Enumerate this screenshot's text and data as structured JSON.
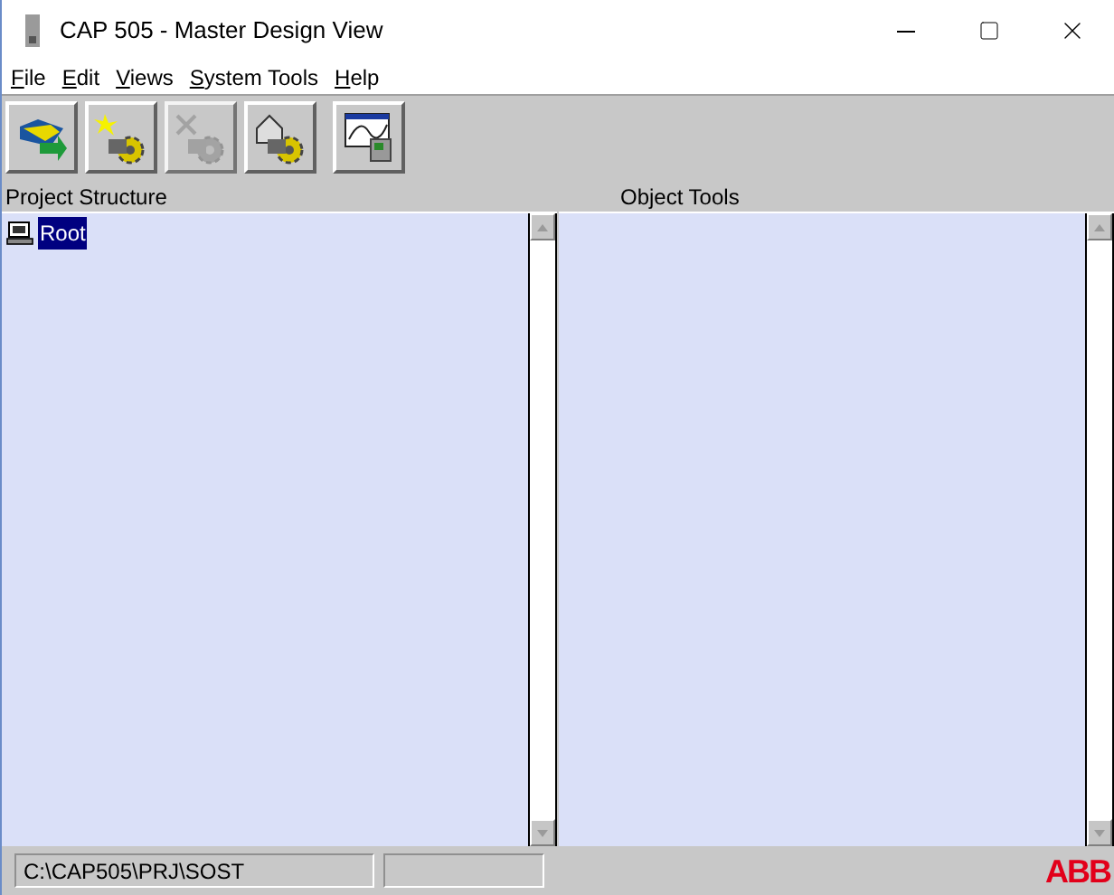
{
  "window": {
    "title": "CAP 505 - Master Design View"
  },
  "menu": [
    {
      "label": "File"
    },
    {
      "label": "Edit"
    },
    {
      "label": "Views"
    },
    {
      "label": "System Tools"
    },
    {
      "label": "Help"
    }
  ],
  "toolbar": [
    {
      "kind": "folder",
      "disabled": false
    },
    {
      "kind": "new",
      "disabled": false
    },
    {
      "kind": "delete",
      "disabled": true
    },
    {
      "kind": "house",
      "disabled": false
    },
    {
      "kind": "monitor",
      "disabled": false
    }
  ],
  "panes": [
    {
      "title": "Project Structure",
      "items": [
        {
          "label": "Root",
          "selected": true
        }
      ]
    },
    {
      "title": "Object Tools"
    }
  ],
  "status_bar": {
    "path": "C:\\CAP505\\PRJ\\SOST",
    "logo": "ABB"
  }
}
